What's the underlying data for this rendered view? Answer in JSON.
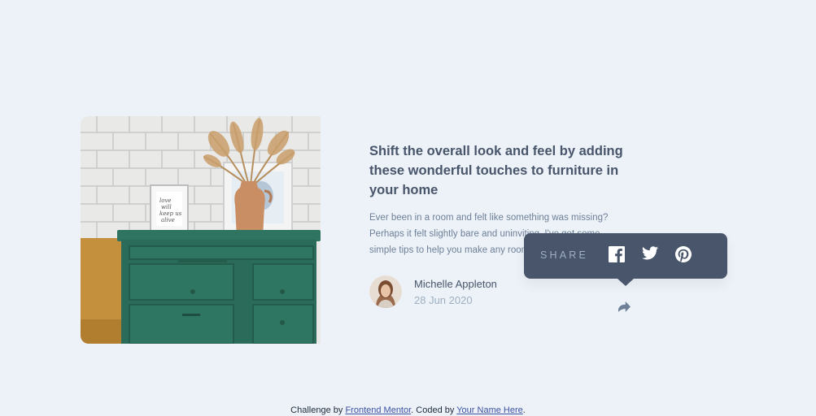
{
  "article": {
    "headline": "Shift the overall look and feel by adding these wonderful touches to furniture in your home",
    "excerpt": "Ever been in a room and felt like something was missing? Perhaps it felt slightly bare and uninviting. I've got some simple tips to help you make any room feel complete.",
    "image_alt": "green drawers with a vase and picture frames"
  },
  "author": {
    "name": "Michelle Appleton",
    "date": "28 Jun 2020"
  },
  "share": {
    "label": "SHARE",
    "icons": [
      "facebook-icon",
      "twitter-icon",
      "pinterest-icon"
    ],
    "button_icon": "share-icon"
  },
  "footer": {
    "prefix": "Challenge by ",
    "link1": "Frontend Mentor",
    "middle": ". Coded by ",
    "link2": "Your Name Here",
    "suffix": "."
  },
  "colors": {
    "background": "#ecf2f8",
    "headline": "#48556a",
    "text": "#6e8098",
    "muted": "#9eafc2",
    "popup": "#48556a"
  }
}
